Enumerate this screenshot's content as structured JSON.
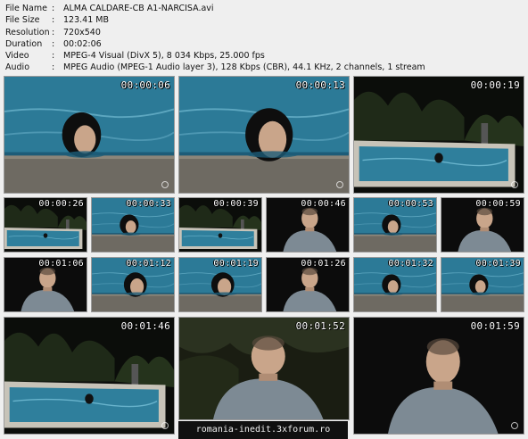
{
  "file_info": {
    "rows": [
      {
        "key": "File Name",
        "sep": ":",
        "value": "ALMA CALDARE-CB A1-NARCISA.avi"
      },
      {
        "key": "File Size",
        "sep": ":",
        "value": "123.41 MB"
      },
      {
        "key": "Resolution",
        "sep": ":",
        "value": "720x540"
      },
      {
        "key": "Duration",
        "sep": ":",
        "value": "00:02:06"
      },
      {
        "key": "Video",
        "sep": ":",
        "value": "MPEG-4 Visual (DivX 5), 8 034 Kbps, 25.000 fps"
      },
      {
        "key": "Audio",
        "sep": ":",
        "value": "MPEG Audio (MPEG-1 Audio layer 3), 128 Kbps (CBR), 44.1 KHz, 2 channels, 1 stream"
      }
    ]
  },
  "thumbnails": [
    {
      "time": "00:00:06",
      "scene": "pool-woman"
    },
    {
      "time": "00:00:13",
      "scene": "pool-woman-close"
    },
    {
      "time": "00:00:19",
      "scene": "pool-wide"
    },
    {
      "time": "00:00:26",
      "scene": "pool-wide"
    },
    {
      "time": "00:00:33",
      "scene": "pool-woman"
    },
    {
      "time": "00:00:39",
      "scene": "pool-wide"
    },
    {
      "time": "00:00:46",
      "scene": "man-night"
    },
    {
      "time": "00:00:53",
      "scene": "pool-woman"
    },
    {
      "time": "00:00:59",
      "scene": "man-night"
    },
    {
      "time": "00:01:06",
      "scene": "man-night"
    },
    {
      "time": "00:01:12",
      "scene": "pool-woman-close"
    },
    {
      "time": "00:01:19",
      "scene": "pool-woman-close"
    },
    {
      "time": "00:01:26",
      "scene": "man-night"
    },
    {
      "time": "00:01:32",
      "scene": "pool-woman"
    },
    {
      "time": "00:01:39",
      "scene": "pool-woman"
    },
    {
      "time": "00:01:46",
      "scene": "pool-wide"
    },
    {
      "time": "00:01:52",
      "scene": "man-trees"
    },
    {
      "time": "00:01:59",
      "scene": "man-bending"
    }
  ],
  "footer": {
    "text": "romania-inedit.3xforum.ro"
  },
  "colors": {
    "pool_water": "#2f7f9c",
    "pool_deep": "#1d5c78",
    "night": "#0c0c0c",
    "skin": "#c9a58a",
    "shirt": "#7d8a94"
  }
}
